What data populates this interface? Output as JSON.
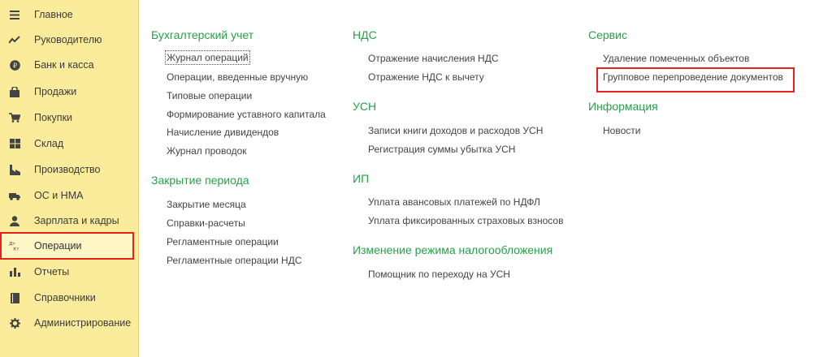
{
  "colors": {
    "sidebar_bg": "#fbec9c",
    "section_title": "#29a04a",
    "highlight": "#e8231b",
    "link_text": "#444444"
  },
  "sidebar": {
    "items": [
      {
        "label": "Главное",
        "icon": "menu-lines-icon"
      },
      {
        "label": "Руководителю",
        "icon": "trend-line-icon"
      },
      {
        "label": "Банк и касса",
        "icon": "coin-icon"
      },
      {
        "label": "Продажи",
        "icon": "shopping-bag-icon"
      },
      {
        "label": "Покупки",
        "icon": "cart-icon"
      },
      {
        "label": "Склад",
        "icon": "warehouse-grid-icon"
      },
      {
        "label": "Производство",
        "icon": "factory-icon"
      },
      {
        "label": "ОС и НМА",
        "icon": "truck-icon"
      },
      {
        "label": "Зарплата и кадры",
        "icon": "person-icon"
      },
      {
        "label": "Операции",
        "icon": "debit-credit-icon"
      },
      {
        "label": "Отчеты",
        "icon": "bar-chart-icon"
      },
      {
        "label": "Справочники",
        "icon": "book-icon"
      },
      {
        "label": "Администрирование",
        "icon": "gear-icon"
      }
    ]
  },
  "main": {
    "col1": {
      "s1_title": "Бухгалтерский учет",
      "s1_links": [
        "Журнал операций",
        "Операции, введенные вручную",
        "Типовые операции",
        "Формирование уставного капитала",
        "Начисление дивидендов",
        "Журнал проводок"
      ],
      "s2_title": "Закрытие периода",
      "s2_links": [
        "Закрытие месяца",
        "Справки-расчеты",
        "Регламентные операции",
        "Регламентные операции НДС"
      ]
    },
    "col2": {
      "s1_title": "НДС",
      "s1_links": [
        "Отражение начисления НДС",
        "Отражение НДС к вычету"
      ],
      "s2_title": "УСН",
      "s2_links": [
        "Записи книги доходов и расходов УСН",
        "Регистрация суммы убытка УСН"
      ],
      "s3_title": "ИП",
      "s3_links": [
        "Уплата авансовых платежей по НДФЛ",
        "Уплата фиксированных страховых взносов"
      ],
      "s4_title": "Изменение режима налогообложения",
      "s4_links": [
        "Помощник по переходу на УСН"
      ]
    },
    "col3": {
      "s1_title": "Сервис",
      "s1_links": [
        "Удаление помеченных объектов",
        "Групповое перепроведение документов"
      ],
      "s2_title": "Информация",
      "s2_links": [
        "Новости"
      ]
    }
  }
}
